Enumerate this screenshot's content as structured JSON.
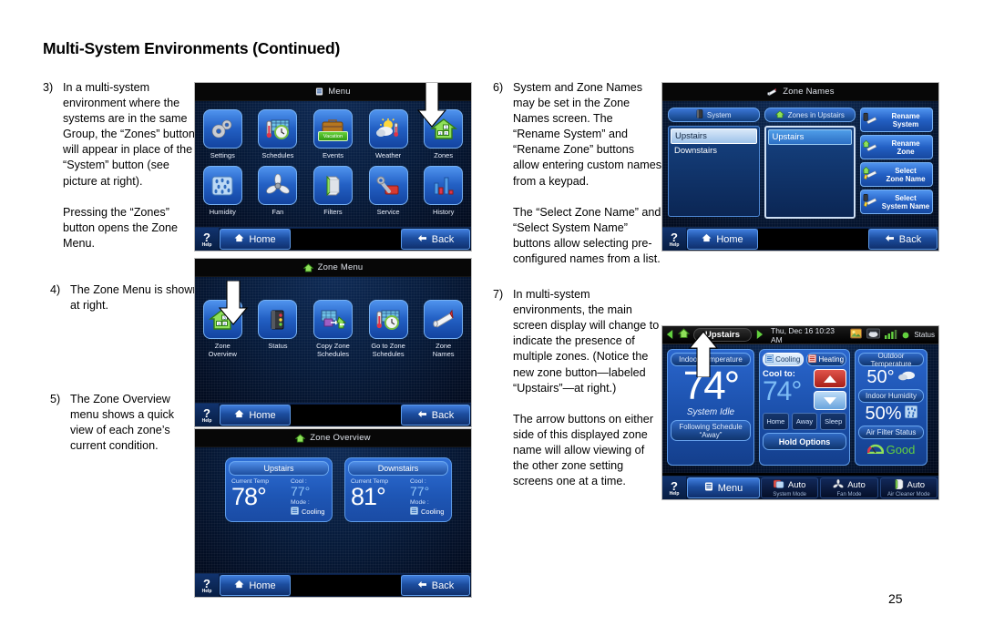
{
  "page": {
    "title": "Multi-System Environments (Continued)",
    "number": "25"
  },
  "left_column": [
    {
      "num": "3)",
      "text": "In a multi-system environment where the systems are in the same Group, the “Zones” button will appear in place of the “System” button (see picture at right)."
    },
    {
      "num": "",
      "text": "Pressing the “Zones” button opens the Zone Menu."
    },
    {
      "num": "4)",
      "text": "The Zone Menu is shown at right."
    },
    {
      "num": "5)",
      "text": "The Zone Overview menu shows a quick view of each zone’s current condition."
    }
  ],
  "right_column": [
    {
      "num": "6)",
      "text": "System and Zone Names may be set in the Zone Names screen.  The “Rename System” and “Rename Zone” buttons allow entering custom names from a keypad."
    },
    {
      "num": "",
      "text": "The “Select Zone Name” and “Select System Name” buttons allow selecting pre-configured names from a list."
    },
    {
      "num": "7)",
      "text": "In multi-system environments, the main screen display will change to indicate the presence of multiple zones.  (Notice the new zone button—labeled “Upstairs”—at right.)"
    },
    {
      "num": "",
      "text": "The arrow buttons on either side of this displayed zone name will allow viewing of the other zone setting screens one at a time."
    }
  ],
  "screens": {
    "menu": {
      "title": "Menu",
      "title_icon": "menu-icon",
      "tiles": [
        {
          "label": "Settings",
          "icon": "gears-icon"
        },
        {
          "label": "Schedules",
          "icon": "schedule-icon"
        },
        {
          "label": "Events",
          "icon": "suitcase-icon",
          "badge": "Vacation"
        },
        {
          "label": "Weather",
          "icon": "weather-icon"
        },
        {
          "label": "Zones",
          "icon": "zones-house-icon"
        },
        {
          "label": "Humidity",
          "icon": "humidity-icon"
        },
        {
          "label": "Fan",
          "icon": "fan-icon"
        },
        {
          "label": "Filters",
          "icon": "filter-icon"
        },
        {
          "label": "Service",
          "icon": "wrench-icon"
        },
        {
          "label": "History",
          "icon": "bar-chart-icon"
        }
      ],
      "help": {
        "mark": "?",
        "label": "Help"
      },
      "home": "Home",
      "back": "Back"
    },
    "zone_menu": {
      "title": "Zone Menu",
      "title_icon": "house-icon",
      "tiles": [
        {
          "label": "Zone\nOverview",
          "icon": "zones-house-icon"
        },
        {
          "label": "Status",
          "icon": "equipment-icon"
        },
        {
          "label": "Copy Zone\nSchedules",
          "icon": "copy-schedule-icon"
        },
        {
          "label": "Go to Zone\nSchedules",
          "icon": "schedule-icon"
        },
        {
          "label": "Zone\nNames",
          "icon": "nametag-icon"
        }
      ],
      "help": {
        "mark": "?",
        "label": "Help"
      },
      "home": "Home",
      "back": "Back"
    },
    "zone_overview": {
      "title": "Zone Overview",
      "title_icon": "house-icon",
      "labels": {
        "current_temp": "Current Temp",
        "cool": "Cool :",
        "mode": "Mode :"
      },
      "zones": [
        {
          "name": "Upstairs",
          "current_temp": "78°",
          "cool": "77°",
          "mode": "Cooling"
        },
        {
          "name": "Downstairs",
          "current_temp": "81°",
          "cool": "77°",
          "mode": "Cooling"
        }
      ],
      "help": {
        "mark": "?",
        "label": "Help"
      },
      "home": "Home",
      "back": "Back"
    },
    "zone_names": {
      "title": "Zone Names",
      "title_icon": "nametag-icon",
      "system_header": "System",
      "system_header_icon": "equipment-icon",
      "zones_header": "Zones in Upstairs",
      "zones_header_icon": "house-icon",
      "system_list": [
        "Upstairs",
        "Downstairs"
      ],
      "system_selected": "Upstairs",
      "zone_list": [
        "Upstairs"
      ],
      "zone_selected": "Upstairs",
      "buttons": [
        {
          "label": "Rename\nSystem",
          "icon": "rename-system-icon"
        },
        {
          "label": "Rename\nZone",
          "icon": "rename-zone-icon"
        },
        {
          "label": "Select\nZone Name",
          "icon": "select-zone-name-icon"
        },
        {
          "label": "Select\nSystem Name",
          "icon": "select-system-name-icon"
        }
      ],
      "help": {
        "mark": "?",
        "label": "Help"
      },
      "home": "Home",
      "back": "Back"
    },
    "main": {
      "zone_name": "Upstairs",
      "datetime": "Thu, Dec 16   10:23 AM",
      "status_label": "Status",
      "indoor": {
        "header": "Indoor Temperature",
        "temp": "74°",
        "state": "System Idle",
        "schedule_line1": "Following Schedule",
        "schedule_line2": "“Away”"
      },
      "control": {
        "cooling_tab": "Cooling",
        "heating_tab": "Heating",
        "active_tab": "Cooling",
        "setpoint_label": "Cool to:",
        "setpoint": "74°",
        "presets": [
          "Home",
          "Away",
          "Sleep"
        ],
        "hold_options": "Hold Options"
      },
      "right": {
        "outdoor_header": "Outdoor Temperature",
        "outdoor_temp": "50°",
        "humidity_header": "Indoor Humidity",
        "humidity": "50%",
        "filter_header": "Air Filter Status",
        "filter_status": "Good"
      },
      "bottom": {
        "help": {
          "mark": "?",
          "label": "Help"
        },
        "menu": "Menu",
        "buttons": [
          {
            "value": "Auto",
            "label": "System Mode",
            "icon": "system-mode-icon"
          },
          {
            "value": "Auto",
            "label": "Fan Mode",
            "icon": "fan-mode-icon"
          },
          {
            "value": "Auto",
            "label": "Air Cleaner Mode",
            "icon": "air-cleaner-icon"
          }
        ]
      }
    }
  },
  "colors": {
    "tile_blue": "#2360c4",
    "panel_blue": "#1a4ea8",
    "accent_cyan": "#7dbcf5",
    "good_green": "#63d13f",
    "heat_red": "#a81f18"
  }
}
